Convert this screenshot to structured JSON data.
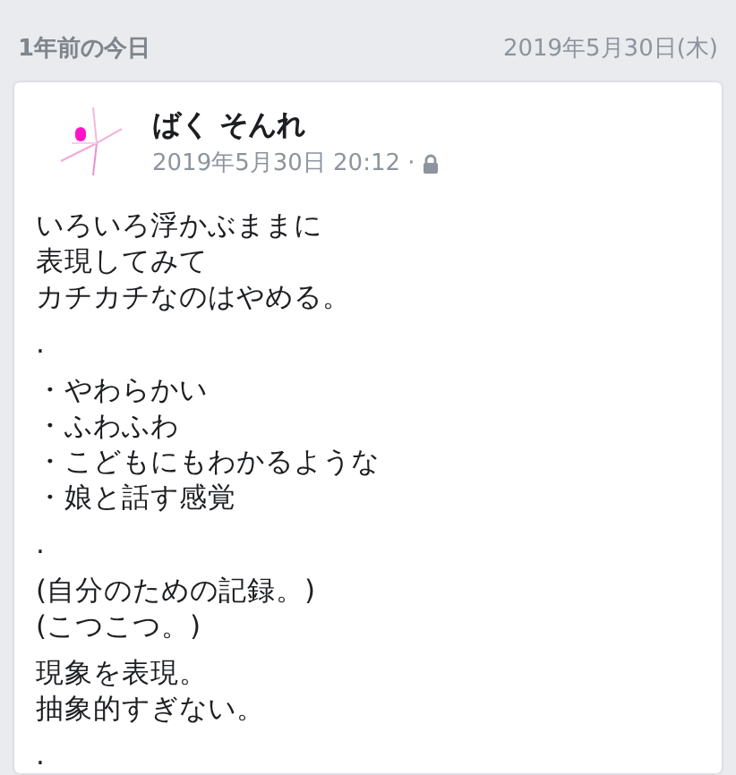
{
  "header": {
    "title": "1年前の今日",
    "date": "2019年5月30日(木)"
  },
  "post": {
    "author": "ばく そんれ",
    "timestamp": "2019年5月30日 20:12 ·",
    "paragraphs": [
      [
        "いろいろ浮かぶままに",
        "表現してみて",
        "カチカチなのはやめる。"
      ],
      [
        "."
      ],
      [
        "・やわらかい",
        "・ふわふわ",
        "・こどもにもわかるような",
        "・娘と話す感覚"
      ],
      [
        "."
      ],
      [
        "(自分のための記録。)",
        "(こつこつ。)"
      ],
      [
        "現象を表現。",
        "抽象的すぎない。"
      ],
      [
        "."
      ]
    ]
  }
}
